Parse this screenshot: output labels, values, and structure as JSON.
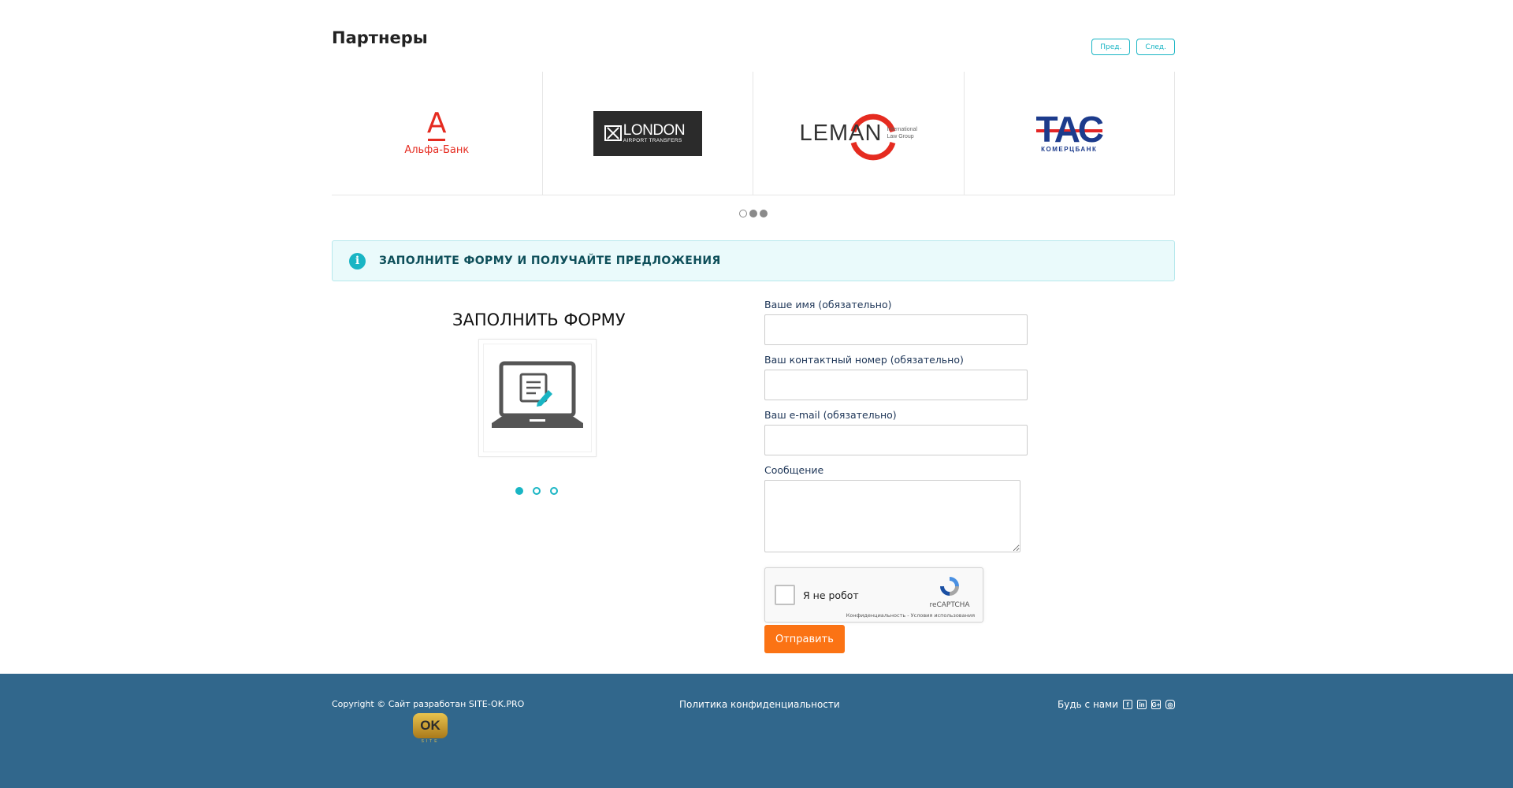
{
  "partners": {
    "title": "Партнеры",
    "prev_label": "Пред.",
    "next_label": "След.",
    "logos": {
      "alfa": {
        "mark": "А",
        "text": "Альфа-Банк"
      },
      "london": {
        "big": "LONDON",
        "small": "AIRPORT TRANSFERS"
      },
      "leman": {
        "word": "LEMAN",
        "sub1": "International",
        "sub2": "Law Group"
      },
      "tas": {
        "word": "ТАС",
        "sub": "КОМЕРЦБАНК"
      }
    }
  },
  "alert": {
    "text": "ЗАПОЛНИТЕ ФОРМУ И ПОЛУЧАЙТЕ ПРЕДЛОЖЕНИЯ"
  },
  "promo": {
    "title": "ЗАПОЛНИТЬ ФОРМУ"
  },
  "form": {
    "name_label": "Ваше имя (обязательно)",
    "phone_label": "Ваш контактный номер (обязательно)",
    "email_label": "Ваш e-mail (обязательно)",
    "message_label": "Сообщение",
    "captcha_label": "Я не робот",
    "captcha_brand": "reCAPTCHA",
    "captcha_terms": "Конфиденциальность - Условия использования",
    "submit_label": "Отправить"
  },
  "footer": {
    "copyright": "Copyright © Сайт разработан SITE-OK.PRO",
    "ok_badge": "OK",
    "ok_site": "SITE",
    "policy": "Политика конфиденциальности",
    "social_label": "Будь с нами",
    "social_icons": {
      "facebook": "f",
      "linkedin": "in",
      "gplus": "G+",
      "instagram": "◎"
    }
  },
  "colors": {
    "accent": "#19b5c4",
    "submit": "#fb7314",
    "footer": "#31678c",
    "alert_bg": "#eafafb"
  }
}
